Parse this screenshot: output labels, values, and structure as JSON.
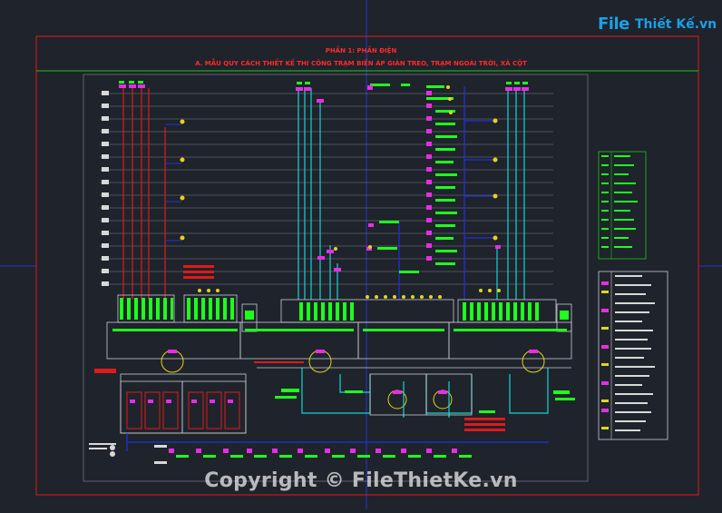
{
  "drawing": {
    "title_line1": "PHẦN 1: PHẦN ĐIỆN",
    "title_line2": "A. MẪU QUY CÁCH THIẾT KẾ THI CÔNG TRẠM BIẾN ÁP GIÀN TREO, TRẠM NGOÀI TRỜI, XÀ CỘT"
  },
  "logo": {
    "brand_file": "File",
    "brand_rest": "Thiết Kế.vn"
  },
  "watermark": {
    "text": "Copyright © FileThietKe.vn"
  },
  "colors": {
    "background": "#1f232b",
    "frame_red": "#e01a1a",
    "frame_green": "#16c816",
    "line_white": "#c9ccd2",
    "cyan": "#15d4d4",
    "magenta": "#e62ee6",
    "bright_green": "#1eff1e",
    "blue": "#2233dd",
    "yellow": "#e8d21a"
  }
}
